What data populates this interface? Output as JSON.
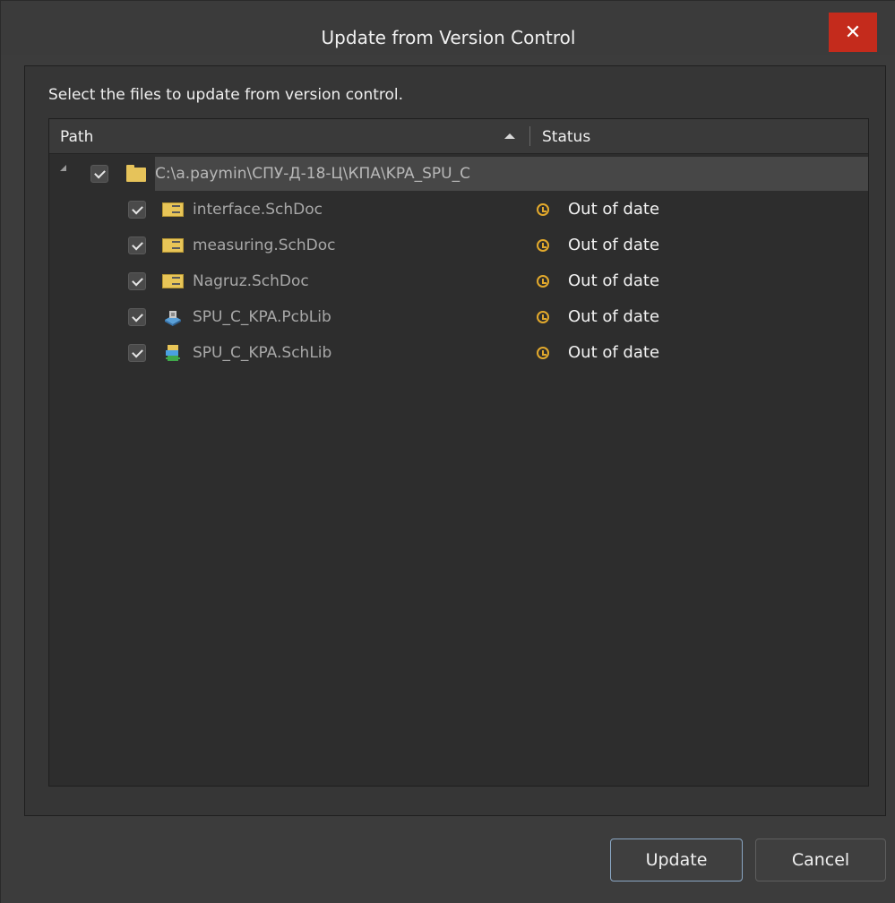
{
  "window": {
    "title": "Update from Version Control",
    "close_glyph": "✕"
  },
  "dialog": {
    "instructions": "Select the files to update from version control."
  },
  "grid": {
    "columns": {
      "path": "Path",
      "status": "Status"
    },
    "root": {
      "label": "C:\\a.paymin\\СПУ-Д-18-Ц\\КПА\\KPA_SPU_C",
      "checked": true,
      "icon": "folder-icon"
    },
    "rows": [
      {
        "label": "interface.SchDoc",
        "status": "Out of date",
        "icon": "schdoc-icon",
        "checked": true
      },
      {
        "label": "measuring.SchDoc",
        "status": "Out of date",
        "icon": "schdoc-icon",
        "checked": true
      },
      {
        "label": "Nagruz.SchDoc",
        "status": "Out of date",
        "icon": "schdoc-icon",
        "checked": true
      },
      {
        "label": "SPU_C_KPA.PcbLib",
        "status": "Out of date",
        "icon": "pcblib-icon",
        "checked": true
      },
      {
        "label": "SPU_C_KPA.SchLib",
        "status": "Out of date",
        "icon": "schlib-icon",
        "checked": true
      }
    ]
  },
  "buttons": {
    "update": "Update",
    "cancel": "Cancel"
  },
  "colors": {
    "close_button": "#c42b1c",
    "status_icon": "#e2a92c",
    "folder": "#e6c35a"
  }
}
